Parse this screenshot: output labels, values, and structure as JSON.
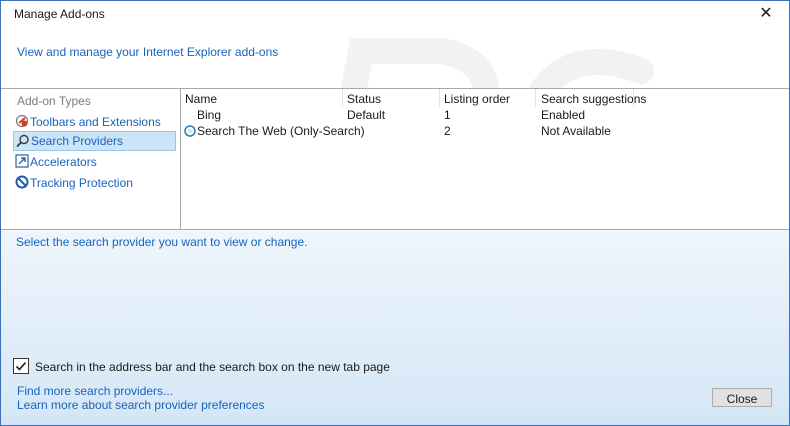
{
  "window": {
    "title": "Manage Add-ons",
    "close_glyph": "✕"
  },
  "header": {
    "link": "View and manage your Internet Explorer add-ons"
  },
  "sidebar": {
    "heading": "Add-on Types",
    "items": [
      {
        "label": "Toolbars and Extensions",
        "icon": "toolbars-icon"
      },
      {
        "label": "Search Providers",
        "icon": "search-icon",
        "selected": true
      },
      {
        "label": "Accelerators",
        "icon": "accelerators-icon"
      },
      {
        "label": "Tracking Protection",
        "icon": "tracking-protection-icon"
      }
    ]
  },
  "list": {
    "columns": [
      "Name",
      "Status",
      "Listing order",
      "Search suggestions"
    ],
    "rows": [
      {
        "name": "Bing",
        "status": "Default",
        "order": "1",
        "suggestions": "Enabled"
      },
      {
        "name": "Search The Web (Only-Search)",
        "status": "",
        "order": "2",
        "suggestions": "Not Available"
      }
    ]
  },
  "bottom": {
    "status": "Select the search provider you want to view or change.",
    "checkbox_label": "Search in the address bar and the search box on the new tab page",
    "checkbox_checked": true,
    "link_find": "Find more search providers...",
    "link_learn": "Learn more about search provider preferences",
    "close_label": "Close"
  },
  "colors": {
    "accent": "#1863bf",
    "border": "#3c6fb5",
    "selection": "#cce4f7"
  }
}
